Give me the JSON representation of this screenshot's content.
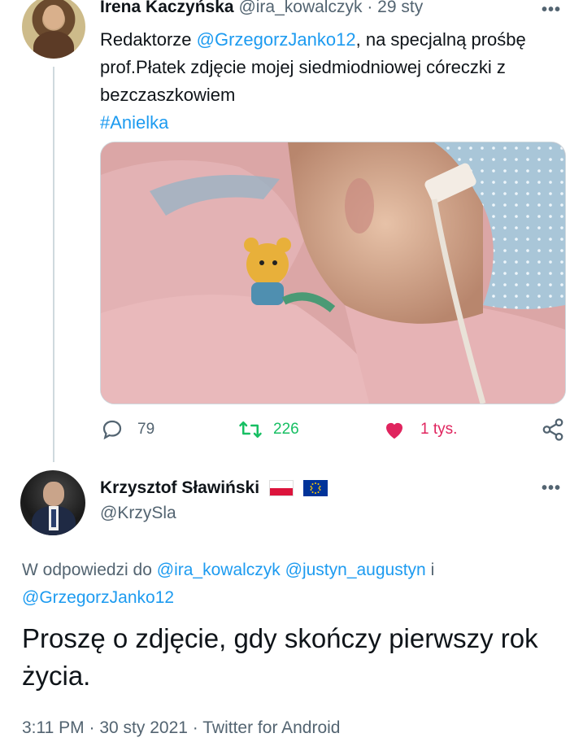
{
  "original_tweet": {
    "author_name": "Irena Kaczyńska",
    "handle": "@ira_kowalczyk",
    "separator": "·",
    "date": "29 sty",
    "more_icon": "more-dots-icon",
    "text_before": "Redaktorze ",
    "mention": "@GrzegorzJanko12",
    "text_after": ", na specjalną prośbę prof.Płatek zdjęcie mojej siedmiodniowej córeczki z bezczaszkowiem",
    "hashtag": "#Anielka",
    "actions": {
      "reply_count": "79",
      "retweet_count": "226",
      "like_count": "1 tys."
    }
  },
  "reply_tweet": {
    "author_name": "Krzysztof Sławiński",
    "flags": [
      "poland-flag-icon",
      "eu-flag-icon"
    ],
    "handle": "@KrzySla",
    "reply_prefix": "W odpowiedzi do",
    "reply_mentions": [
      "@ira_kowalczyk",
      "@justyn_augustyn",
      "@GrzegorzJanko12"
    ],
    "reply_and": "i",
    "text": "Proszę o zdjęcie, gdy skończy pierwszy rok życia.",
    "time": "3:11 PM",
    "separator": "·",
    "date": "30 sty 2021",
    "client": "Twitter for Android"
  },
  "colors": {
    "link": "#1d9bf0",
    "muted": "#536471",
    "retweet": "#17bf63",
    "like": "#e0245e",
    "thread_line": "#cfd9de"
  }
}
